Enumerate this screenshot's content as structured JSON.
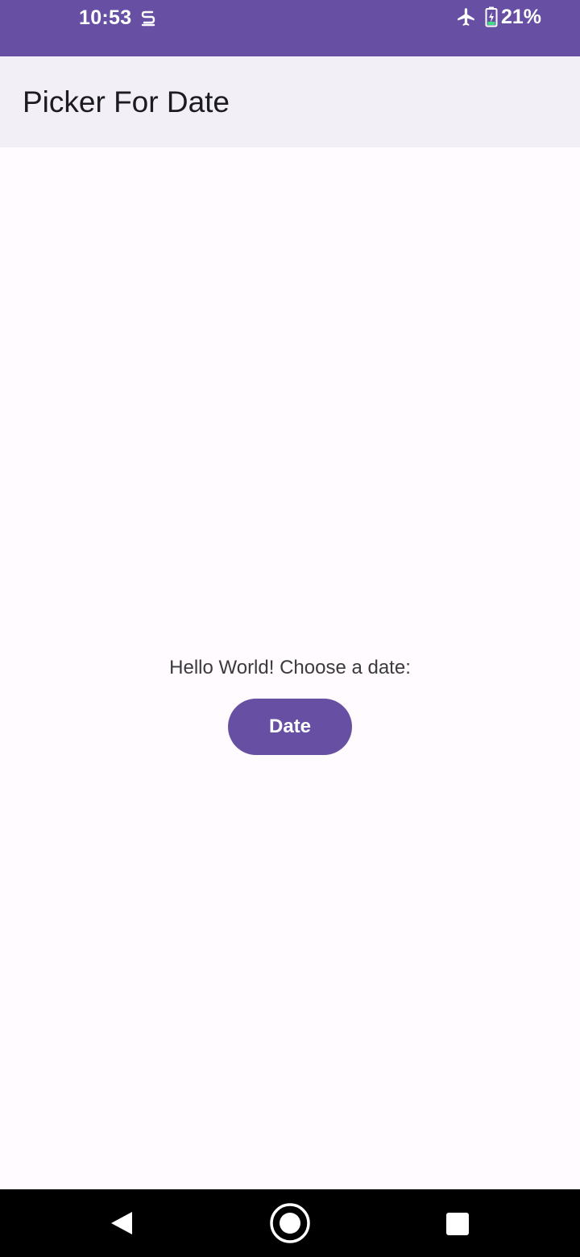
{
  "status_bar": {
    "time": "10:53",
    "battery": "21%",
    "icons": [
      "s-notification-icon",
      "airplane-mode-icon",
      "battery-charging-icon"
    ],
    "color": "#6750a4"
  },
  "app_bar": {
    "title": "Picker For Date"
  },
  "main": {
    "prompt": "Hello World! Choose a date:",
    "date_button_label": "Date"
  },
  "nav_bar": {
    "icons": [
      "back-icon",
      "home-icon",
      "recents-icon"
    ]
  },
  "colors": {
    "primary": "#6750a4",
    "app_bar_bg": "#f2eff7",
    "background": "#fffbfe"
  }
}
